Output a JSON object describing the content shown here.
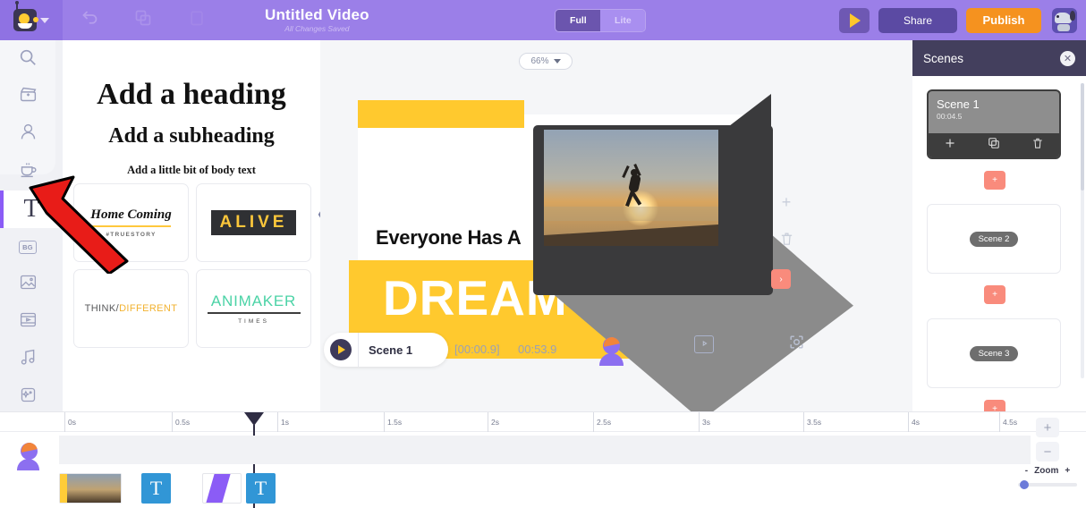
{
  "header": {
    "logo_icon": "animaker-robot-logo",
    "dropdown_icon": "chevron-down-icon",
    "undo_icon": "undo-icon",
    "copy_icon": "duplicate-icon",
    "paste_icon": "paste-icon",
    "title": "Untitled Video",
    "save_status": "All Changes Saved",
    "mode_toggle": {
      "full_label": "Full",
      "lite_label": "Lite",
      "selected": "Full"
    },
    "preview_icon": "play-icon",
    "share_label": "Share",
    "publish_label": "Publish",
    "avatar_icon": "dog-avatar-icon",
    "brand_purple": "#9b7fe8",
    "publish_orange": "#f5921f"
  },
  "rail": {
    "items": [
      {
        "name": "search",
        "icon": "search-icon",
        "label": ""
      },
      {
        "name": "video",
        "icon": "clapperboard-icon",
        "label": ""
      },
      {
        "name": "character",
        "icon": "character-icon",
        "label": ""
      },
      {
        "name": "prop",
        "icon": "prop-coffee-icon",
        "label": ""
      },
      {
        "name": "text",
        "icon": "text-T-icon",
        "label": "T",
        "active": true
      },
      {
        "name": "background",
        "icon": "bg-icon",
        "label": "BG"
      },
      {
        "name": "image",
        "icon": "image-icon",
        "label": ""
      },
      {
        "name": "video-clip",
        "icon": "film-strip-icon",
        "label": ""
      },
      {
        "name": "music",
        "icon": "music-note-icon",
        "label": ""
      },
      {
        "name": "effects",
        "icon": "sparkle-effects-icon",
        "label": ""
      },
      {
        "name": "upload",
        "icon": "upload-icon",
        "label": ""
      }
    ]
  },
  "text_panel": {
    "heading": "Add a heading",
    "subheading": "Add a subheading",
    "body": "Add a little bit of body text",
    "collapse_icon": "chevron-left-icon",
    "templates": [
      {
        "id": "home-coming",
        "title": "Home Coming",
        "tag": "#TRUESTORY"
      },
      {
        "id": "alive",
        "title": "ALIVE"
      },
      {
        "id": "think-different",
        "title_a": "THINK/",
        "title_b": "DIFFERENT"
      },
      {
        "id": "animaker-times",
        "title": "ANIMAKER",
        "subtitle": "TIMES"
      }
    ]
  },
  "stage": {
    "zoom_level": "66%",
    "zoom_caret_icon": "chevron-down-icon",
    "slide": {
      "title_line": "Everyone Has A",
      "big_word": "DREAM",
      "photo_alt": "person-jumping-on-beach-at-sunset"
    },
    "tools": {
      "add_icon": "plus-icon",
      "delete_icon": "trash-icon",
      "split_icon": "split-icon"
    },
    "player": {
      "play_icon": "play-icon",
      "scene_label": "Scene 1",
      "current_time": "[00:00.9]",
      "total_time": "00:53.9"
    },
    "bottom_tools": [
      {
        "name": "character",
        "icon": "character-icon"
      },
      {
        "name": "clip",
        "icon": "video-frame-icon"
      },
      {
        "name": "focus",
        "icon": "focus-crop-icon"
      }
    ]
  },
  "scenes_panel": {
    "title": "Scenes",
    "close_icon": "close-icon",
    "add_between_icon": "plus-icon",
    "scenes": [
      {
        "name": "Scene 1",
        "duration": "00:04.5",
        "selected": true,
        "tools": [
          {
            "name": "add-scene",
            "icon": "plus-icon"
          },
          {
            "name": "duplicate-scene",
            "icon": "duplicate-icon"
          },
          {
            "name": "delete-scene",
            "icon": "trash-icon"
          }
        ]
      },
      {
        "name": "Scene 2",
        "duration": "",
        "selected": false
      },
      {
        "name": "Scene 3",
        "duration": "",
        "selected": false
      }
    ]
  },
  "timeline": {
    "ticks": [
      "0s",
      "0.5s",
      "1s",
      "1.5s",
      "2s",
      "2.5s",
      "3s",
      "3.5s",
      "4s",
      "4.5s"
    ],
    "playhead_time": "0.9s",
    "row_icon": "character-icon",
    "clips": [
      {
        "name": "image-clip",
        "type": "image",
        "label": ""
      },
      {
        "name": "text-clip-1",
        "type": "text",
        "label": "T"
      },
      {
        "name": "shape-clip",
        "type": "shape",
        "label": ""
      },
      {
        "name": "text-clip-2",
        "type": "text",
        "label": "T"
      }
    ],
    "zoom_in_icon": "plus-icon",
    "zoom_out_icon": "minus-icon",
    "zoom_minus_label": "-",
    "zoom_label": "Zoom",
    "zoom_plus_label": "+",
    "add_track_icon": "plus-icon"
  },
  "annotation": {
    "arrow_color": "#e81c18",
    "points_to": "text-tool-in-sidebar"
  }
}
